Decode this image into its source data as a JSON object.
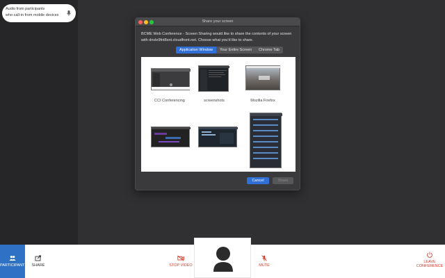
{
  "audio_note": {
    "line1": "Audio from participants",
    "line2": "who call-in from mobile devices",
    "icon": "microphone-icon"
  },
  "dialog": {
    "title": "Share your screen",
    "description": "BCME Web Conference - Screen Sharing would like to share the contents of your screen with dnvle9fnt8xnt.cloudfront.net. Choose what you'd like to share.",
    "tabs": [
      "Application Window",
      "Your Entire Screen",
      "Chrome Tab"
    ],
    "active_tab": "Application Window",
    "windows": [
      {
        "label": "CCI Conferencing"
      },
      {
        "label": "screenshots"
      },
      {
        "label": "Mozilla Firefox"
      },
      {
        "label": ""
      },
      {
        "label": ""
      },
      {
        "label": ""
      }
    ],
    "cancel_label": "Cancel",
    "share_label": "Share"
  },
  "toolbar": {
    "participants_label": "PARTICIPANTS",
    "share_label": "SHARE",
    "stop_video_label": "STOP VIDEO",
    "mute_label": "MUTE",
    "leave_label_1": "LEAVE",
    "leave_label_2": "CONFERENCE"
  },
  "colors": {
    "accent": "#2f6fd6",
    "danger": "#d93a2b",
    "participants_bg": "#2d72c4"
  }
}
